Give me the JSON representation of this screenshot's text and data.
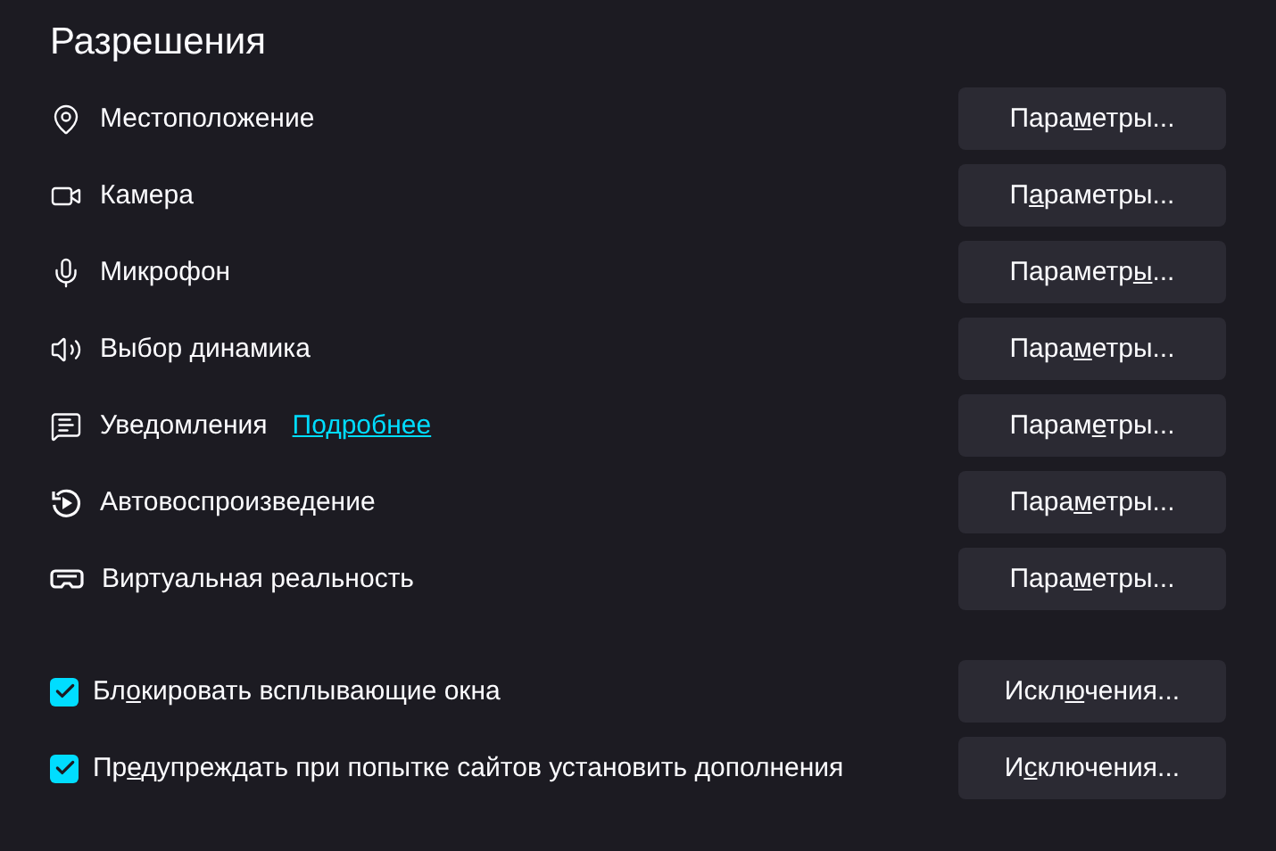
{
  "title": "Разрешения",
  "permissions": [
    {
      "kind": "location",
      "label": "Местоположение",
      "button": {
        "before": "Пара",
        "key": "м",
        "after": "етры..."
      }
    },
    {
      "kind": "camera",
      "label": "Камера",
      "button": {
        "before": "П",
        "key": "а",
        "after": "раметры..."
      }
    },
    {
      "kind": "microphone",
      "label": "Микрофон",
      "button": {
        "before": "Параметр",
        "key": "ы",
        "after": "..."
      }
    },
    {
      "kind": "speaker",
      "label": "Выбор динамика",
      "button": {
        "before": "Пара",
        "key": "м",
        "after": "етры..."
      }
    },
    {
      "kind": "notifications",
      "label": "Уведомления",
      "link": "Подробнее",
      "button": {
        "before": "Парам",
        "key": "е",
        "after": "тры..."
      }
    },
    {
      "kind": "autoplay",
      "label": "Автовоспроизведение",
      "button": {
        "before": "Пара",
        "key": "м",
        "after": "етры..."
      }
    },
    {
      "kind": "vr",
      "label": "Виртуальная реальность",
      "button": {
        "before": "Пара",
        "key": "м",
        "after": "етры..."
      }
    }
  ],
  "options": [
    {
      "checked": true,
      "label": {
        "before": "Бл",
        "key": "о",
        "after": "кировать всплывающие окна"
      },
      "button": {
        "before": "Искл",
        "key": "ю",
        "after": "чения..."
      }
    },
    {
      "checked": true,
      "label": {
        "before": "Пр",
        "key": "е",
        "after": "дупреждать при попытке сайтов установить дополнения"
      },
      "button": {
        "before": "И",
        "key": "с",
        "after": "ключения..."
      }
    }
  ]
}
